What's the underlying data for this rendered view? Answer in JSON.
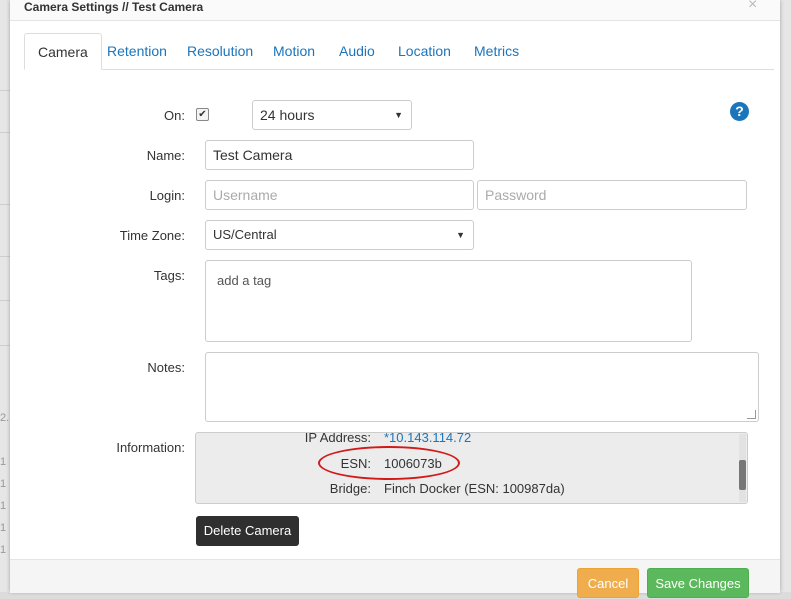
{
  "modal": {
    "title": "Camera Settings // Test Camera",
    "close_symbol": "×"
  },
  "tabs": [
    {
      "label": "Camera"
    },
    {
      "label": "Retention"
    },
    {
      "label": "Resolution"
    },
    {
      "label": "Motion"
    },
    {
      "label": "Audio"
    },
    {
      "label": "Location"
    },
    {
      "label": "Metrics"
    }
  ],
  "form": {
    "on_label": "On:",
    "on_checked": true,
    "on_duration": "24 hours",
    "name_label": "Name:",
    "name_value": "Test Camera",
    "login_label": "Login:",
    "username_placeholder": "Username",
    "password_placeholder": "Password",
    "timezone_label": "Time Zone:",
    "timezone_value": "US/Central",
    "tags_label": "Tags:",
    "tags_placeholder": "add a tag",
    "notes_label": "Notes:",
    "information_label": "Information:"
  },
  "information": [
    {
      "key": "IP Address:",
      "value": "*10.143.114.72"
    },
    {
      "key": "ESN:",
      "value": "1006073b"
    },
    {
      "key": "Bridge:",
      "value": "Finch Docker (ESN: 100987da)"
    }
  ],
  "buttons": {
    "delete": "Delete Camera",
    "cancel": "Cancel",
    "save": "Save Changes"
  },
  "background_numbers": [
    "2.",
    "1",
    "1",
    "1",
    "1",
    "1"
  ],
  "colors": {
    "link": "#1b75bb",
    "cancel": "#f0ad4e",
    "save": "#5cb85c",
    "delete": "#2f2f2f",
    "annotation": "#d21a1a"
  }
}
